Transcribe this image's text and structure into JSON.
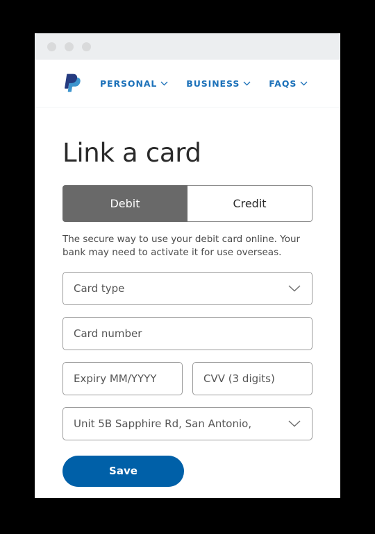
{
  "window": {
    "dots": [
      "close-dot",
      "minimize-dot",
      "maximize-dot"
    ]
  },
  "nav": {
    "logo_name": "paypal-logo",
    "logo_colors": {
      "dark_blue": "#253B80",
      "light_blue": "#3d95ce"
    },
    "links": [
      {
        "label": "PERSONAL",
        "icon": "chevron-down-icon"
      },
      {
        "label": "BUSINESS",
        "icon": "chevron-down-icon"
      },
      {
        "label": "FAQS",
        "icon": "chevron-down-icon"
      }
    ],
    "link_color": "#1c71b9"
  },
  "main": {
    "title": "Link a card",
    "toggle": {
      "options": [
        {
          "label": "Debit",
          "selected": true
        },
        {
          "label": "Credit",
          "selected": false
        }
      ],
      "active_background": "#696969"
    },
    "description": "The secure way to use your debit card online. Your bank may need to activate it for use overseas.",
    "fields": {
      "card_type": {
        "value": "Card type",
        "placeholder": "Card type",
        "icon": "chevron-down-icon"
      },
      "card_number": {
        "value": "",
        "placeholder": "Card number"
      },
      "expiry": {
        "value": "",
        "placeholder": "Expiry MM/YYYY"
      },
      "cvv": {
        "value": "",
        "placeholder": "CVV (3 digits)"
      },
      "billing_address": {
        "value": "Unit 5B Sapphire Rd, San Antonio,",
        "icon": "chevron-down-icon"
      }
    },
    "save_label": "Save",
    "save_color": "#0060a8"
  }
}
